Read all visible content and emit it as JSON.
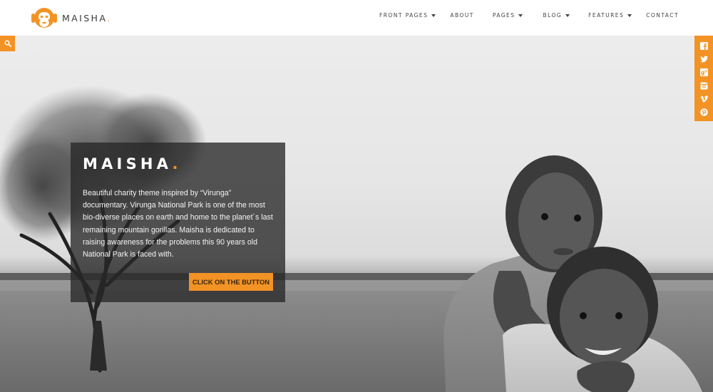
{
  "header": {
    "logo_text": "MAISHA",
    "logo_dot": ".",
    "nav": [
      {
        "label": "FRONT PAGES",
        "dropdown": true
      },
      {
        "label": "ABOUT",
        "dropdown": false
      },
      {
        "label": "PAGES",
        "dropdown": true
      },
      {
        "label": "BLOG",
        "dropdown": true
      },
      {
        "label": "FEATURES",
        "dropdown": true
      },
      {
        "label": "CONTACT",
        "dropdown": false
      }
    ]
  },
  "search": {
    "icon": "search-icon"
  },
  "social": [
    {
      "name": "facebook",
      "icon": "facebook-icon"
    },
    {
      "name": "twitter",
      "icon": "twitter-icon"
    },
    {
      "name": "google-plus",
      "icon": "google-plus-icon"
    },
    {
      "name": "instagram",
      "icon": "instagram-icon"
    },
    {
      "name": "vimeo",
      "icon": "vimeo-icon"
    },
    {
      "name": "pinterest",
      "icon": "pinterest-icon"
    }
  ],
  "hero": {
    "title": "MAISHA",
    "title_dot": ".",
    "description": "Beautiful charity theme inspired by “Virunga” documentary. Virunga National Park is one of the most bio-diverse places on earth and home to the planet´s last remaining mountain gorillas. Maisha is dedicated to raising awareness for the problems this 90 years old National Park is faced with.",
    "button_label": "CLICK ON THE BUTTON",
    "image_description": "Black and white photo of a savanna with a lone acacia tree on the left and two smiling boys embracing on the right"
  },
  "colors": {
    "accent": "#f39325",
    "nav_text": "#444444",
    "overlay": "#282828"
  }
}
